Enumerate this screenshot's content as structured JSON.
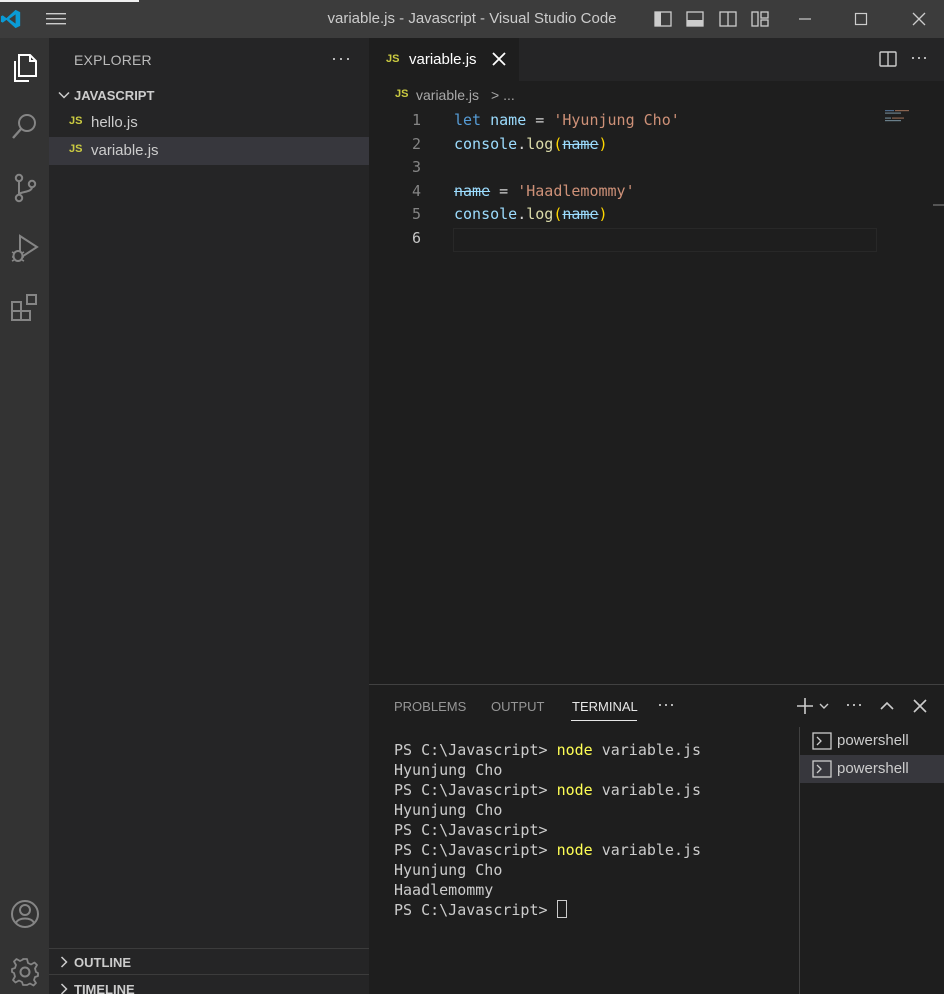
{
  "window": {
    "title": "variable.js - Javascript - Visual Studio Code"
  },
  "activity_bar": {
    "items": [
      "explorer-icon",
      "search-icon",
      "source-control-icon",
      "run-debug-icon",
      "extensions-icon"
    ],
    "bottom_items": [
      "account-icon",
      "settings-gear-icon"
    ]
  },
  "sidebar": {
    "header": "EXPLORER",
    "more": "···",
    "folder": "JAVASCRIPT",
    "files": [
      {
        "badge": "JS",
        "name": "hello.js"
      },
      {
        "badge": "JS",
        "name": "variable.js"
      }
    ],
    "selected_file": "variable.js",
    "outline": "OUTLINE",
    "timeline": "TIMELINE"
  },
  "editor": {
    "tab": {
      "badge": "JS",
      "name": "variable.js"
    },
    "more": "···",
    "breadcrumb": {
      "badge": "JS",
      "file": "variable.js",
      "sep": "> ..."
    },
    "lines": [
      {
        "n": "1",
        "tokens": [
          {
            "t": "let",
            "c": "kw"
          },
          {
            "t": " ",
            "c": "plain"
          },
          {
            "t": "name",
            "c": "var"
          },
          {
            "t": " = ",
            "c": "plain"
          },
          {
            "t": "'Hyunjung Cho'",
            "c": "str"
          }
        ]
      },
      {
        "n": "2",
        "tokens": [
          {
            "t": "console",
            "c": "var"
          },
          {
            "t": ".",
            "c": "plain"
          },
          {
            "t": "log",
            "c": "fn"
          },
          {
            "t": "(",
            "c": "paren"
          },
          {
            "t": "name",
            "c": "var strike"
          },
          {
            "t": ")",
            "c": "paren"
          }
        ]
      },
      {
        "n": "3",
        "tokens": []
      },
      {
        "n": "4",
        "tokens": [
          {
            "t": "name",
            "c": "var strike"
          },
          {
            "t": " = ",
            "c": "plain"
          },
          {
            "t": "'Haadlemommy'",
            "c": "str"
          }
        ]
      },
      {
        "n": "5",
        "tokens": [
          {
            "t": "console",
            "c": "var"
          },
          {
            "t": ".",
            "c": "plain"
          },
          {
            "t": "log",
            "c": "fn"
          },
          {
            "t": "(",
            "c": "paren"
          },
          {
            "t": "name",
            "c": "var strike"
          },
          {
            "t": ")",
            "c": "paren"
          }
        ]
      },
      {
        "n": "6",
        "tokens": []
      }
    ],
    "active_line": "6"
  },
  "panel": {
    "tabs": [
      "PROBLEMS",
      "OUTPUT",
      "TERMINAL"
    ],
    "active_tab": "TERMINAL",
    "more": "···",
    "terminal_lines": [
      {
        "prompt": "PS C:\\Javascript> ",
        "cmd": "node",
        "args": " variable.js"
      },
      {
        "prompt": "Hyunjung Cho",
        "cmd": "",
        "args": ""
      },
      {
        "prompt": "PS C:\\Javascript> ",
        "cmd": "node",
        "args": " variable.js"
      },
      {
        "prompt": "Hyunjung Cho",
        "cmd": "",
        "args": ""
      },
      {
        "prompt": "PS C:\\Javascript>",
        "cmd": "",
        "args": ""
      },
      {
        "prompt": "PS C:\\Javascript> ",
        "cmd": "node",
        "args": " variable.js"
      },
      {
        "prompt": "Hyunjung Cho",
        "cmd": "",
        "args": ""
      },
      {
        "prompt": "Haadlemommy",
        "cmd": "",
        "args": ""
      },
      {
        "prompt": "PS C:\\Javascript> ",
        "cmd": "",
        "args": "",
        "cursor": true
      }
    ],
    "terminals": [
      "powershell",
      "powershell"
    ],
    "active_terminal_index": 1
  },
  "colors": {
    "titlebar": "#3c3c3c",
    "activitybar": "#333333",
    "sidebar": "#252526",
    "editor": "#1e1e1e",
    "accent": "#0078d4",
    "js_badge": "#cbcb41"
  }
}
